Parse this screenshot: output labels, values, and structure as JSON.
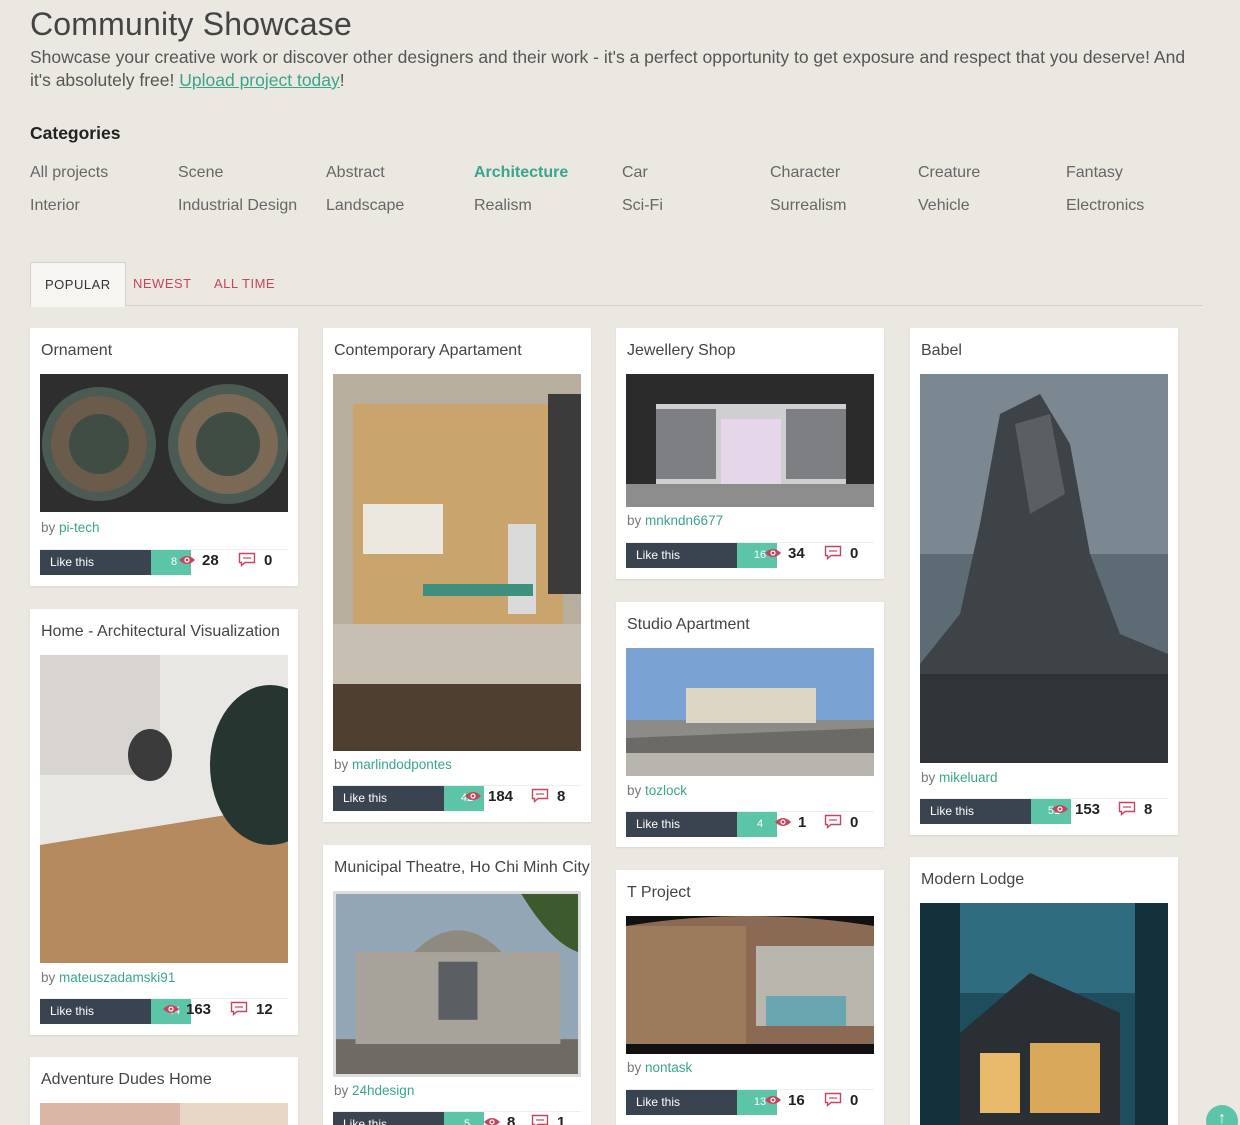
{
  "header": {
    "title": "Community Showcase",
    "intro_text": "Showcase your creative work or discover other designers and their work - it's a perfect opportunity to get exposure and respect that you deserve! And it's absolutely free! ",
    "intro_link": "Upload project today",
    "intro_end": "!"
  },
  "categories": {
    "heading": "Categories",
    "items": [
      "All projects",
      "Scene",
      "Abstract",
      "Architecture",
      "Car",
      "Character",
      "Creature",
      "Fantasy",
      "Interior",
      "Industrial Design",
      "Landscape",
      "Realism",
      "Sci-Fi",
      "Surrealism",
      "Vehicle",
      "Electronics"
    ],
    "active": "Architecture"
  },
  "tabs": [
    {
      "label": "POPULAR",
      "active": true
    },
    {
      "label": "NEWEST",
      "active": false
    },
    {
      "label": "ALL TIME",
      "active": false
    }
  ],
  "like_label": "Like this",
  "by_prefix": "by ",
  "cards": [
    {
      "title": "Ornament",
      "author": "pi-tech",
      "likes": "8",
      "views": "28",
      "comments": "0"
    },
    {
      "title": "Home - Architectural Visualization",
      "author": "mateuszadamski91",
      "likes": "44",
      "views": "163",
      "comments": "12"
    },
    {
      "title": "Adventure Dudes Home"
    },
    {
      "title": "Contemporary Apartament",
      "author": "marlindodpontes",
      "likes": "42",
      "views": "184",
      "comments": "8"
    },
    {
      "title": "Municipal Theatre, Ho Chi Minh City",
      "author": "24hdesign",
      "likes": "5",
      "views": "8",
      "comments": "1"
    },
    {
      "title": "Jewellery Shop",
      "author": "mnkndn6677",
      "likes": "16",
      "views": "34",
      "comments": "0"
    },
    {
      "title": "Studio Apartment",
      "author": "tozlock",
      "likes": "4",
      "views": "1",
      "comments": "0"
    },
    {
      "title": "T Project",
      "author": "nontask",
      "likes": "13",
      "views": "16",
      "comments": "0"
    },
    {
      "title": "Babel",
      "author": "mikeluard",
      "likes": "51",
      "views": "153",
      "comments": "8"
    },
    {
      "title": "Modern Lodge"
    }
  ],
  "scroll_top_icon": "arrow-up-icon"
}
